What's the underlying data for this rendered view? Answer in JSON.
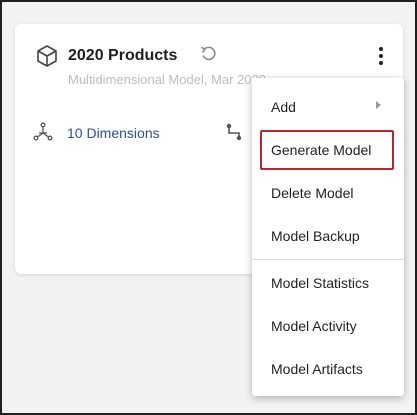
{
  "card": {
    "title": "2020 Products",
    "subtitle": "Multidimensional Model, Mar 2020",
    "dimensions_link": "10 Dimensions",
    "icons": {
      "model": "cube-icon",
      "refresh": "refresh-icon",
      "menu": "more-vertical-icon",
      "dimensions": "dimensions-icon",
      "relations": "relation-icon"
    }
  },
  "menu": {
    "items": [
      {
        "label": "Add",
        "submenu": true
      },
      {
        "label": "Generate Model",
        "highlighted": true
      },
      {
        "label": "Delete Model"
      },
      {
        "label": "Model Backup"
      },
      {
        "label": "Model Statistics"
      },
      {
        "label": "Model Activity"
      },
      {
        "label": "Model Artifacts"
      }
    ]
  },
  "colors": {
    "link": "#2f4f96",
    "highlight_border": "#b3282d",
    "subtitle": "#bdbdbd",
    "background": "#f2f2f2"
  }
}
